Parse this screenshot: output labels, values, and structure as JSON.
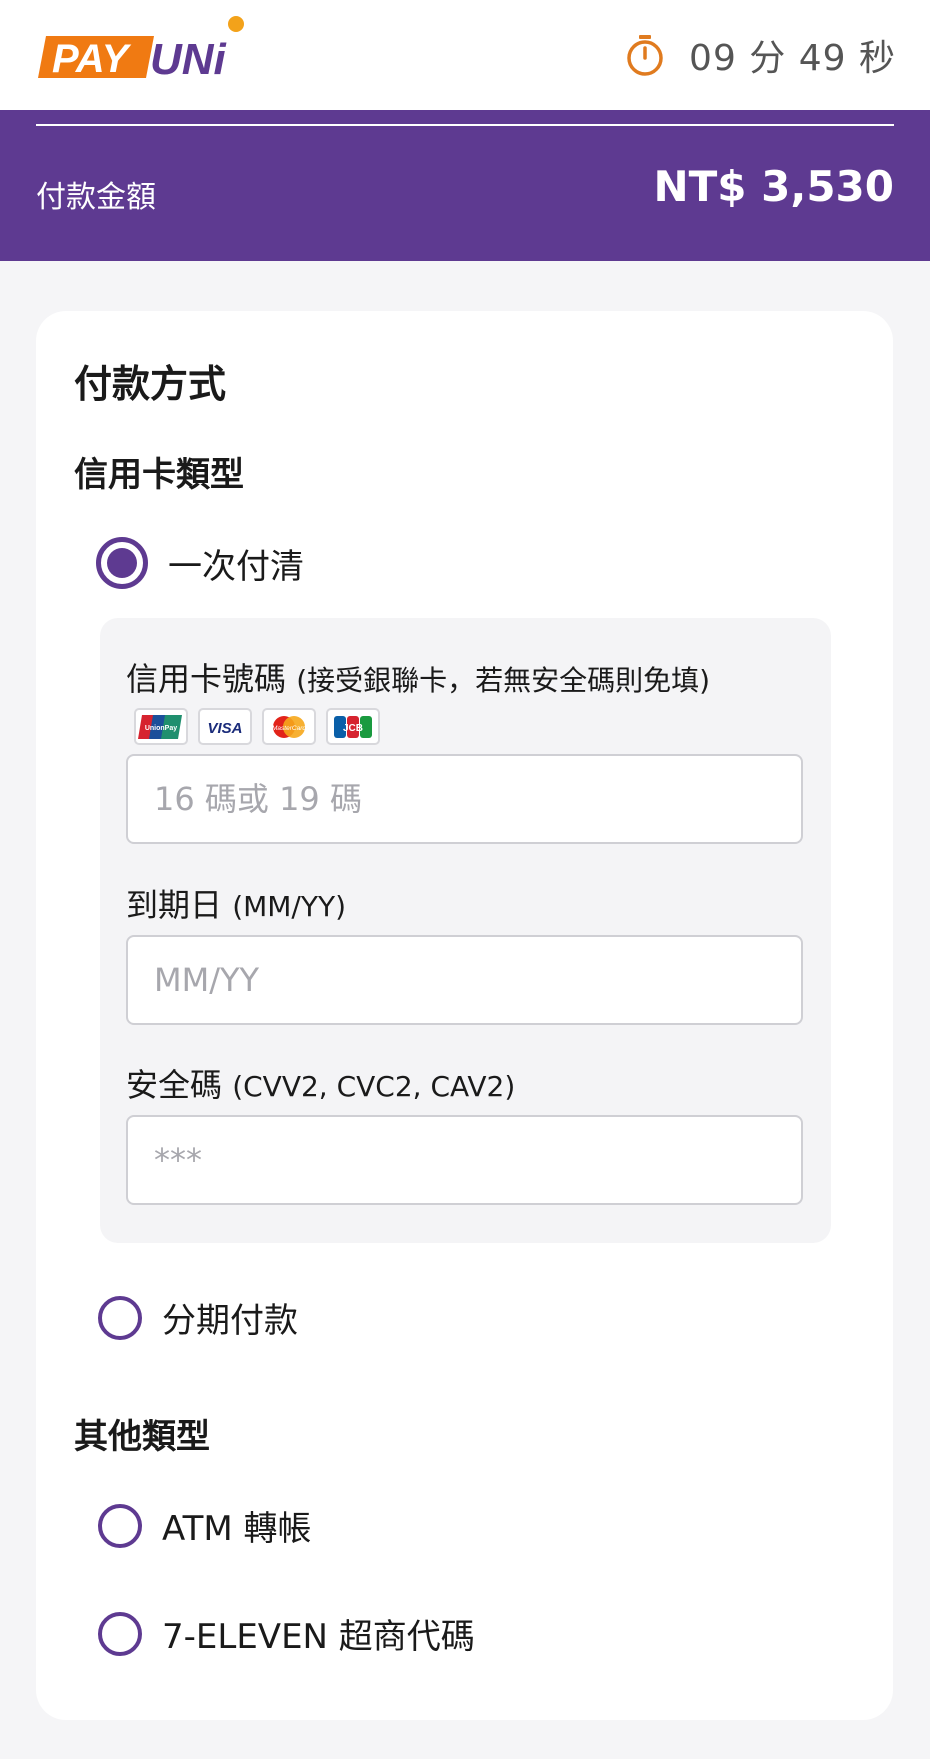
{
  "header": {
    "logo_text": "PAYUNi",
    "timer_text": "09 分 49 秒"
  },
  "amount": {
    "label": "付款金額",
    "value": "NT$ 3,530"
  },
  "payment": {
    "title": "付款方式",
    "credit_group": {
      "title": "信用卡類型",
      "options": [
        {
          "label": "一次付清",
          "selected": true
        },
        {
          "label": "分期付款",
          "selected": false
        }
      ],
      "form": {
        "card_number": {
          "label": "信用卡號碼",
          "note": "(接受銀聯卡，若無安全碼則免填)",
          "placeholder": "16 碼或 19 碼"
        },
        "card_brands": [
          "UnionPay",
          "VISA",
          "MasterCard",
          "JCB"
        ],
        "card_brand_icons": [
          "unionpay-icon",
          "visa-icon",
          "mastercard-icon",
          "jcb-icon"
        ],
        "expiry": {
          "label": "到期日",
          "note": "(MM/YY)",
          "placeholder": "MM/YY"
        },
        "cvv": {
          "label": "安全碼",
          "note": "(CVV2, CVC2, CAV2)",
          "placeholder": "***"
        }
      }
    },
    "other_group": {
      "title": "其他類型",
      "options": [
        {
          "label": "ATM 轉帳",
          "selected": false
        },
        {
          "label": "7-ELEVEN 超商代碼",
          "selected": false
        }
      ]
    }
  },
  "colors": {
    "brand_purple": "#5e3a91",
    "brand_orange": "#f07a12",
    "timer_orange": "#e07b1f"
  }
}
